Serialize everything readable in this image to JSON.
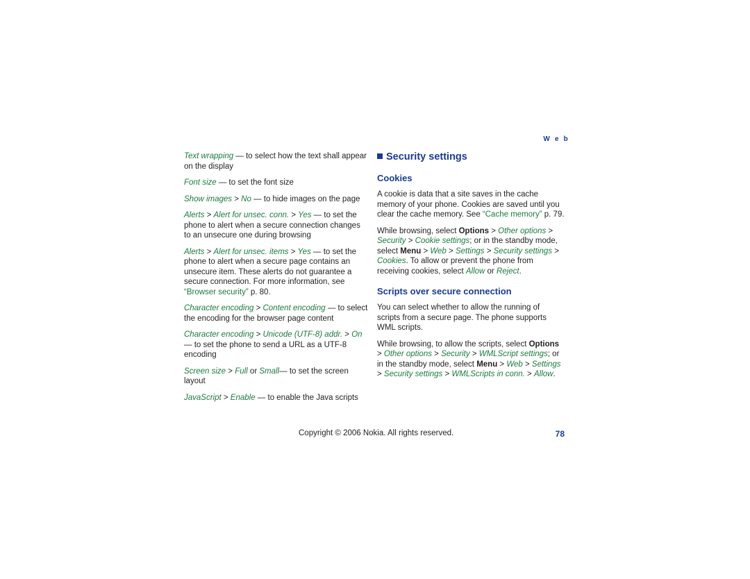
{
  "header": {
    "running_head": "W e b"
  },
  "left_column": {
    "paragraphs": [
      [
        {
          "t": "Text wrapping",
          "s": "it"
        },
        {
          "t": " — to select how the text shall appear on the display",
          "s": ""
        }
      ],
      [
        {
          "t": "Font size",
          "s": "it"
        },
        {
          "t": " — to set the font size",
          "s": ""
        }
      ],
      [
        {
          "t": "Show images",
          "s": "it"
        },
        {
          "t": " > ",
          "s": ""
        },
        {
          "t": "No",
          "s": "it"
        },
        {
          "t": " — to hide images on the page",
          "s": ""
        }
      ],
      [
        {
          "t": "Alerts",
          "s": "it"
        },
        {
          "t": " > ",
          "s": ""
        },
        {
          "t": "Alert for unsec. conn.",
          "s": "it"
        },
        {
          "t": " > ",
          "s": ""
        },
        {
          "t": "Yes",
          "s": "it"
        },
        {
          "t": " — to set the phone to alert when a secure connection changes to an unsecure one during browsing",
          "s": ""
        }
      ],
      [
        {
          "t": "Alerts",
          "s": "it"
        },
        {
          "t": " > ",
          "s": ""
        },
        {
          "t": "Alert for unsec. items",
          "s": "it"
        },
        {
          "t": " > ",
          "s": ""
        },
        {
          "t": "Yes",
          "s": "it"
        },
        {
          "t": " — to set the phone to alert when a secure page contains an unsecure item. These alerts do not guarantee a secure connection. For more information, see ",
          "s": ""
        },
        {
          "t": "“Browser security”",
          "s": "quoted"
        },
        {
          "t": " p. 80.",
          "s": ""
        }
      ],
      [
        {
          "t": "Character encoding",
          "s": "it"
        },
        {
          "t": " > ",
          "s": ""
        },
        {
          "t": "Content encoding",
          "s": "it"
        },
        {
          "t": " — to select the encoding for the browser page content",
          "s": ""
        }
      ],
      [
        {
          "t": "Character encoding",
          "s": "it"
        },
        {
          "t": " > ",
          "s": ""
        },
        {
          "t": "Unicode (UTF-8) addr.",
          "s": "it"
        },
        {
          "t": " > ",
          "s": ""
        },
        {
          "t": "On",
          "s": "it"
        },
        {
          "t": " — to set the phone to send a URL as a UTF-8 encoding",
          "s": ""
        }
      ],
      [
        {
          "t": "Screen size",
          "s": "it"
        },
        {
          "t": " > ",
          "s": ""
        },
        {
          "t": "Full",
          "s": "it"
        },
        {
          "t": " or ",
          "s": ""
        },
        {
          "t": "Small",
          "s": "it"
        },
        {
          "t": "— to set the screen layout",
          "s": ""
        }
      ],
      [
        {
          "t": "JavaScript",
          "s": "it"
        },
        {
          "t": " > ",
          "s": ""
        },
        {
          "t": "Enable",
          "s": "it"
        },
        {
          "t": " — to enable the Java scripts",
          "s": ""
        }
      ]
    ]
  },
  "right_column": {
    "section_title": "Security settings",
    "sub1_title": "Cookies",
    "sub1_paragraphs": [
      [
        {
          "t": "A cookie is data that a site saves in the cache memory of your phone. Cookies are saved until you clear the cache memory. See ",
          "s": ""
        },
        {
          "t": "“Cache memory”",
          "s": "quoted"
        },
        {
          "t": " p. 79.",
          "s": ""
        }
      ],
      [
        {
          "t": "While browsing, select ",
          "s": ""
        },
        {
          "t": "Options",
          "s": "b"
        },
        {
          "t": " > ",
          "s": ""
        },
        {
          "t": "Other options",
          "s": "it"
        },
        {
          "t": " > ",
          "s": ""
        },
        {
          "t": "Security",
          "s": "it"
        },
        {
          "t": " > ",
          "s": ""
        },
        {
          "t": "Cookie settings",
          "s": "it"
        },
        {
          "t": "; or in the standby mode, select ",
          "s": ""
        },
        {
          "t": "Menu",
          "s": "b"
        },
        {
          "t": " > ",
          "s": ""
        },
        {
          "t": "Web",
          "s": "it"
        },
        {
          "t": " > ",
          "s": ""
        },
        {
          "t": "Settings",
          "s": "it"
        },
        {
          "t": " > ",
          "s": ""
        },
        {
          "t": "Security settings",
          "s": "it"
        },
        {
          "t": " > ",
          "s": ""
        },
        {
          "t": "Cookies",
          "s": "it"
        },
        {
          "t": ". To allow or prevent the phone from receiving cookies, select ",
          "s": ""
        },
        {
          "t": "Allow",
          "s": "it"
        },
        {
          "t": " or ",
          "s": ""
        },
        {
          "t": "Reject",
          "s": "it"
        },
        {
          "t": ".",
          "s": ""
        }
      ]
    ],
    "sub2_title": "Scripts over secure connection",
    "sub2_paragraphs": [
      [
        {
          "t": "You can select whether to allow the running of scripts from a secure page. The phone supports WML scripts.",
          "s": ""
        }
      ],
      [
        {
          "t": "While browsing, to allow the scripts, select ",
          "s": ""
        },
        {
          "t": "Options",
          "s": "b"
        },
        {
          "t": " > ",
          "s": ""
        },
        {
          "t": "Other options",
          "s": "it"
        },
        {
          "t": " > ",
          "s": ""
        },
        {
          "t": "Security",
          "s": "it"
        },
        {
          "t": " > ",
          "s": ""
        },
        {
          "t": "WMLScript settings",
          "s": "it"
        },
        {
          "t": "; or in the standby mode, select ",
          "s": ""
        },
        {
          "t": "Menu",
          "s": "b"
        },
        {
          "t": " > ",
          "s": ""
        },
        {
          "t": "Web",
          "s": "it"
        },
        {
          "t": " > ",
          "s": ""
        },
        {
          "t": "Settings",
          "s": "it"
        },
        {
          "t": " > ",
          "s": ""
        },
        {
          "t": "Security settings",
          "s": "it"
        },
        {
          "t": " > ",
          "s": ""
        },
        {
          "t": "WMLScripts in conn.",
          "s": "it"
        },
        {
          "t": " > ",
          "s": ""
        },
        {
          "t": "Allow",
          "s": "it"
        },
        {
          "t": ".",
          "s": ""
        }
      ]
    ]
  },
  "footer": {
    "copyright": "Copyright © 2006 Nokia. All rights reserved.",
    "page_number": "78"
  }
}
